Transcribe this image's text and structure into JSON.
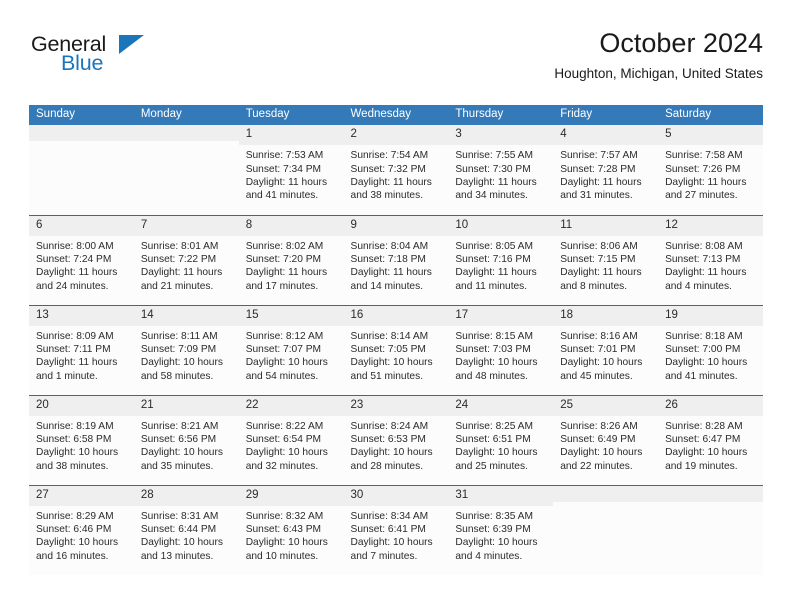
{
  "brand": {
    "name_top": "General",
    "name_bottom": "Blue",
    "triangle_color": "#1b75bb"
  },
  "header": {
    "title": "October 2024",
    "subtitle": "Houghton, Michigan, United States",
    "accent_color": "#3479b8",
    "row_border_color": "#2a6ca8",
    "daynum_band_color": "#efefef"
  },
  "weekday_headers": [
    "Sunday",
    "Monday",
    "Tuesday",
    "Wednesday",
    "Thursday",
    "Friday",
    "Saturday"
  ],
  "labels": {
    "sunrise": "Sunrise:",
    "sunset": "Sunset:",
    "daylight": "Daylight:"
  },
  "weeks": [
    [
      {
        "day": "",
        "empty": true
      },
      {
        "day": "",
        "empty": true
      },
      {
        "day": "1",
        "sunrise": "Sunrise: 7:53 AM",
        "sunset": "Sunset: 7:34 PM",
        "daylight_line1": "Daylight: 11 hours",
        "daylight_line2": "and 41 minutes."
      },
      {
        "day": "2",
        "sunrise": "Sunrise: 7:54 AM",
        "sunset": "Sunset: 7:32 PM",
        "daylight_line1": "Daylight: 11 hours",
        "daylight_line2": "and 38 minutes."
      },
      {
        "day": "3",
        "sunrise": "Sunrise: 7:55 AM",
        "sunset": "Sunset: 7:30 PM",
        "daylight_line1": "Daylight: 11 hours",
        "daylight_line2": "and 34 minutes."
      },
      {
        "day": "4",
        "sunrise": "Sunrise: 7:57 AM",
        "sunset": "Sunset: 7:28 PM",
        "daylight_line1": "Daylight: 11 hours",
        "daylight_line2": "and 31 minutes."
      },
      {
        "day": "5",
        "sunrise": "Sunrise: 7:58 AM",
        "sunset": "Sunset: 7:26 PM",
        "daylight_line1": "Daylight: 11 hours",
        "daylight_line2": "and 27 minutes."
      }
    ],
    [
      {
        "day": "6",
        "sunrise": "Sunrise: 8:00 AM",
        "sunset": "Sunset: 7:24 PM",
        "daylight_line1": "Daylight: 11 hours",
        "daylight_line2": "and 24 minutes."
      },
      {
        "day": "7",
        "sunrise": "Sunrise: 8:01 AM",
        "sunset": "Sunset: 7:22 PM",
        "daylight_line1": "Daylight: 11 hours",
        "daylight_line2": "and 21 minutes."
      },
      {
        "day": "8",
        "sunrise": "Sunrise: 8:02 AM",
        "sunset": "Sunset: 7:20 PM",
        "daylight_line1": "Daylight: 11 hours",
        "daylight_line2": "and 17 minutes."
      },
      {
        "day": "9",
        "sunrise": "Sunrise: 8:04 AM",
        "sunset": "Sunset: 7:18 PM",
        "daylight_line1": "Daylight: 11 hours",
        "daylight_line2": "and 14 minutes."
      },
      {
        "day": "10",
        "sunrise": "Sunrise: 8:05 AM",
        "sunset": "Sunset: 7:16 PM",
        "daylight_line1": "Daylight: 11 hours",
        "daylight_line2": "and 11 minutes."
      },
      {
        "day": "11",
        "sunrise": "Sunrise: 8:06 AM",
        "sunset": "Sunset: 7:15 PM",
        "daylight_line1": "Daylight: 11 hours",
        "daylight_line2": "and 8 minutes."
      },
      {
        "day": "12",
        "sunrise": "Sunrise: 8:08 AM",
        "sunset": "Sunset: 7:13 PM",
        "daylight_line1": "Daylight: 11 hours",
        "daylight_line2": "and 4 minutes."
      }
    ],
    [
      {
        "day": "13",
        "sunrise": "Sunrise: 8:09 AM",
        "sunset": "Sunset: 7:11 PM",
        "daylight_line1": "Daylight: 11 hours",
        "daylight_line2": "and 1 minute."
      },
      {
        "day": "14",
        "sunrise": "Sunrise: 8:11 AM",
        "sunset": "Sunset: 7:09 PM",
        "daylight_line1": "Daylight: 10 hours",
        "daylight_line2": "and 58 minutes."
      },
      {
        "day": "15",
        "sunrise": "Sunrise: 8:12 AM",
        "sunset": "Sunset: 7:07 PM",
        "daylight_line1": "Daylight: 10 hours",
        "daylight_line2": "and 54 minutes."
      },
      {
        "day": "16",
        "sunrise": "Sunrise: 8:14 AM",
        "sunset": "Sunset: 7:05 PM",
        "daylight_line1": "Daylight: 10 hours",
        "daylight_line2": "and 51 minutes."
      },
      {
        "day": "17",
        "sunrise": "Sunrise: 8:15 AM",
        "sunset": "Sunset: 7:03 PM",
        "daylight_line1": "Daylight: 10 hours",
        "daylight_line2": "and 48 minutes."
      },
      {
        "day": "18",
        "sunrise": "Sunrise: 8:16 AM",
        "sunset": "Sunset: 7:01 PM",
        "daylight_line1": "Daylight: 10 hours",
        "daylight_line2": "and 45 minutes."
      },
      {
        "day": "19",
        "sunrise": "Sunrise: 8:18 AM",
        "sunset": "Sunset: 7:00 PM",
        "daylight_line1": "Daylight: 10 hours",
        "daylight_line2": "and 41 minutes."
      }
    ],
    [
      {
        "day": "20",
        "sunrise": "Sunrise: 8:19 AM",
        "sunset": "Sunset: 6:58 PM",
        "daylight_line1": "Daylight: 10 hours",
        "daylight_line2": "and 38 minutes."
      },
      {
        "day": "21",
        "sunrise": "Sunrise: 8:21 AM",
        "sunset": "Sunset: 6:56 PM",
        "daylight_line1": "Daylight: 10 hours",
        "daylight_line2": "and 35 minutes."
      },
      {
        "day": "22",
        "sunrise": "Sunrise: 8:22 AM",
        "sunset": "Sunset: 6:54 PM",
        "daylight_line1": "Daylight: 10 hours",
        "daylight_line2": "and 32 minutes."
      },
      {
        "day": "23",
        "sunrise": "Sunrise: 8:24 AM",
        "sunset": "Sunset: 6:53 PM",
        "daylight_line1": "Daylight: 10 hours",
        "daylight_line2": "and 28 minutes."
      },
      {
        "day": "24",
        "sunrise": "Sunrise: 8:25 AM",
        "sunset": "Sunset: 6:51 PM",
        "daylight_line1": "Daylight: 10 hours",
        "daylight_line2": "and 25 minutes."
      },
      {
        "day": "25",
        "sunrise": "Sunrise: 8:26 AM",
        "sunset": "Sunset: 6:49 PM",
        "daylight_line1": "Daylight: 10 hours",
        "daylight_line2": "and 22 minutes."
      },
      {
        "day": "26",
        "sunrise": "Sunrise: 8:28 AM",
        "sunset": "Sunset: 6:47 PM",
        "daylight_line1": "Daylight: 10 hours",
        "daylight_line2": "and 19 minutes."
      }
    ],
    [
      {
        "day": "27",
        "sunrise": "Sunrise: 8:29 AM",
        "sunset": "Sunset: 6:46 PM",
        "daylight_line1": "Daylight: 10 hours",
        "daylight_line2": "and 16 minutes."
      },
      {
        "day": "28",
        "sunrise": "Sunrise: 8:31 AM",
        "sunset": "Sunset: 6:44 PM",
        "daylight_line1": "Daylight: 10 hours",
        "daylight_line2": "and 13 minutes."
      },
      {
        "day": "29",
        "sunrise": "Sunrise: 8:32 AM",
        "sunset": "Sunset: 6:43 PM",
        "daylight_line1": "Daylight: 10 hours",
        "daylight_line2": "and 10 minutes."
      },
      {
        "day": "30",
        "sunrise": "Sunrise: 8:34 AM",
        "sunset": "Sunset: 6:41 PM",
        "daylight_line1": "Daylight: 10 hours",
        "daylight_line2": "and 7 minutes."
      },
      {
        "day": "31",
        "sunrise": "Sunrise: 8:35 AM",
        "sunset": "Sunset: 6:39 PM",
        "daylight_line1": "Daylight: 10 hours",
        "daylight_line2": "and 4 minutes."
      },
      {
        "day": "",
        "empty": true
      },
      {
        "day": "",
        "empty": true
      }
    ]
  ]
}
